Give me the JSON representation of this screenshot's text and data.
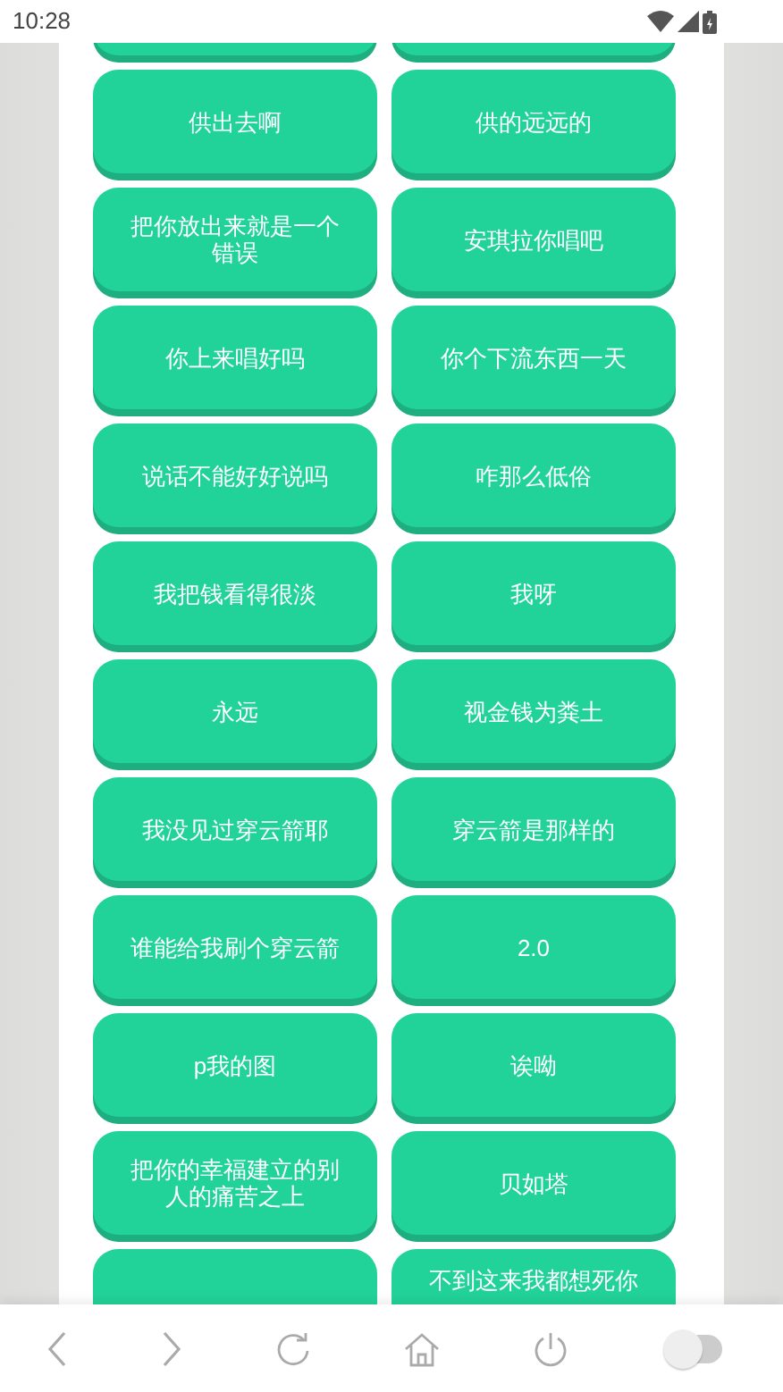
{
  "status_bar": {
    "time": "10:28"
  },
  "buttons": [
    {
      "kind": "blank"
    },
    {
      "kind": "blank"
    },
    {
      "kind": "text",
      "label": "供出去啊"
    },
    {
      "kind": "text",
      "label": "供的远远的"
    },
    {
      "kind": "text",
      "label": "把你放出来就是一个错误"
    },
    {
      "kind": "text",
      "label": "安琪拉你唱吧"
    },
    {
      "kind": "text",
      "label": "你上来唱好吗"
    },
    {
      "kind": "text",
      "label": "你个下流东西一天"
    },
    {
      "kind": "text",
      "label": "说话不能好好说吗"
    },
    {
      "kind": "text",
      "label": "咋那么低俗"
    },
    {
      "kind": "text",
      "label": "我把钱看得很淡"
    },
    {
      "kind": "text",
      "label": "我呀"
    },
    {
      "kind": "text",
      "label": "永远"
    },
    {
      "kind": "text",
      "label": "视金钱为粪土"
    },
    {
      "kind": "text",
      "label": "我没见过穿云箭耶"
    },
    {
      "kind": "text",
      "label": "穿云箭是那样的"
    },
    {
      "kind": "text",
      "label": "谁能给我刷个穿云箭"
    },
    {
      "kind": "text",
      "label": "2.0"
    },
    {
      "kind": "text",
      "label": "p我的图"
    },
    {
      "kind": "text",
      "label": "诶呦"
    },
    {
      "kind": "text",
      "label": "把你的幸福建立的别人的痛苦之上"
    },
    {
      "kind": "text",
      "label": "贝如塔"
    },
    {
      "kind": "blank"
    },
    {
      "kind": "cut",
      "label": "不到这来我都想死你"
    }
  ],
  "toolbar": {
    "toggle": {
      "on": false
    }
  }
}
